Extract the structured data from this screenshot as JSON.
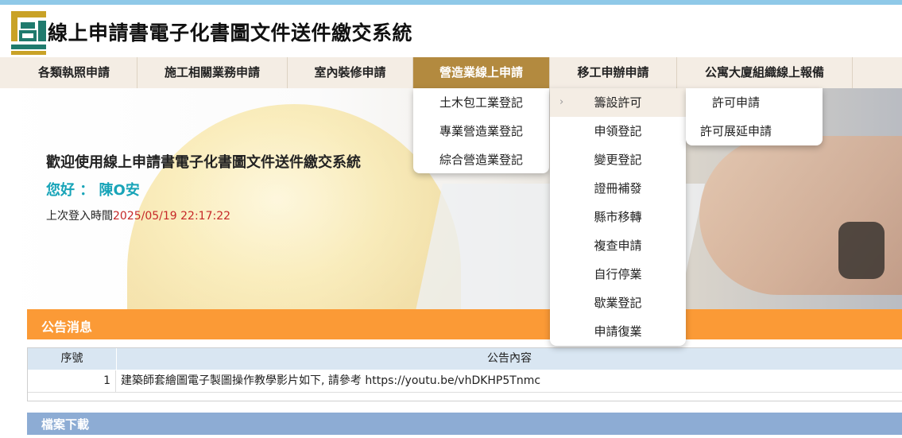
{
  "header": {
    "title": "線上申請書電子化書圖文件送件繳交系統",
    "logo_colors": {
      "gold": "#c9a227",
      "teal": "#1f7a6d"
    }
  },
  "nav": {
    "items": [
      {
        "label": "各類執照申請"
      },
      {
        "label": "施工相關業務申請"
      },
      {
        "label": "室內裝修申請"
      },
      {
        "label": "營造業線上申請",
        "active": true
      },
      {
        "label": "移工申辦申請"
      },
      {
        "label": "公寓大廈組織線上報備"
      }
    ],
    "active_color": "#b38a3f"
  },
  "menu_level1": {
    "items": [
      {
        "label": "土木包工業登記"
      },
      {
        "label": "專業營造業登記"
      },
      {
        "label": "綜合營造業登記"
      }
    ]
  },
  "menu_level2": {
    "items": [
      {
        "label": "籌設許可",
        "highlighted": true
      },
      {
        "label": "申領登記"
      },
      {
        "label": "變更登記"
      },
      {
        "label": "證冊補發"
      },
      {
        "label": "縣市移轉"
      },
      {
        "label": "複查申請"
      },
      {
        "label": "自行停業"
      },
      {
        "label": "歇業登記"
      },
      {
        "label": "申請復業"
      }
    ],
    "chevron_icon": "chevron-right-icon"
  },
  "menu_level3": {
    "items": [
      {
        "label": "許可申請"
      },
      {
        "label": "許可展延申請"
      }
    ]
  },
  "hero": {
    "welcome": "歡迎使用線上申請書電子化書圖文件送件繳交系統",
    "greeting": "您好 ： 陳O安",
    "last_login_label": "上次登入時間",
    "last_login_time": "2025/05/19 22:17:22"
  },
  "announcements": {
    "title": "公告消息",
    "color": "#fb9a36",
    "columns": [
      "序號",
      "公告內容"
    ],
    "rows": [
      {
        "no": "1",
        "content": "建築師套繪圖電子製圖操作教學影片如下, 請參考 https://youtu.be/vhDKHP5Tnmc"
      }
    ]
  },
  "downloads": {
    "title": "檔案下載",
    "color": "#8dacd4"
  }
}
